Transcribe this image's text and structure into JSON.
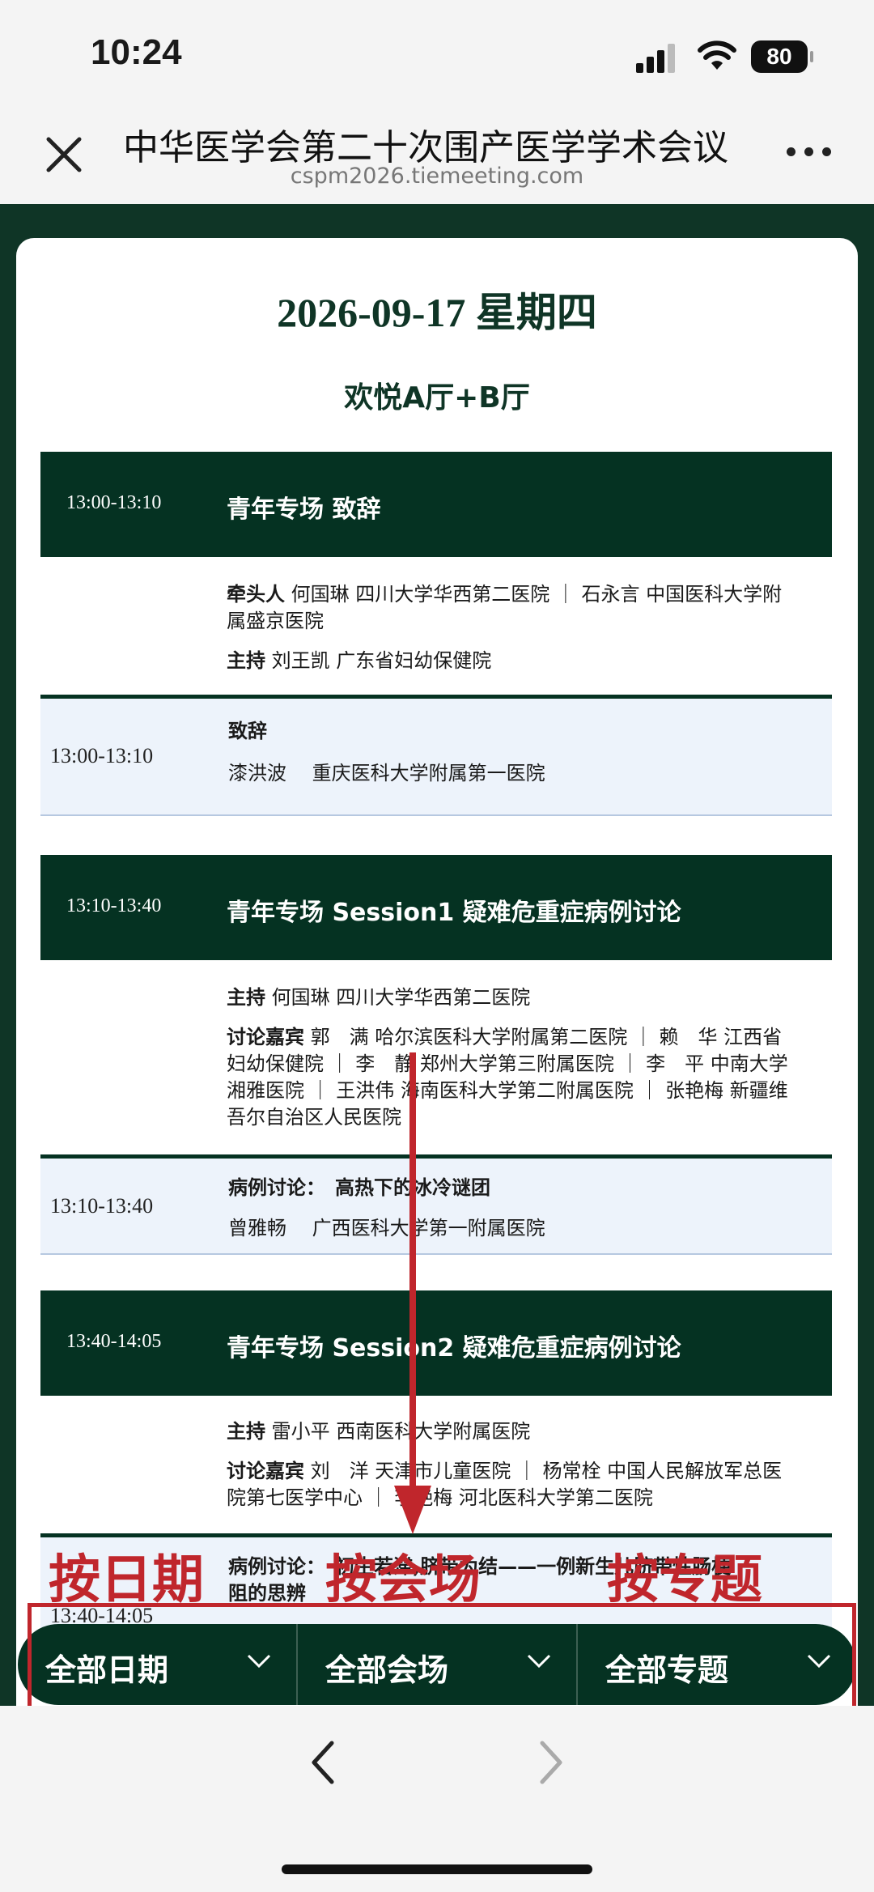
{
  "status": {
    "time": "10:24",
    "battery": "80"
  },
  "browser": {
    "title": "中华医学会第二十次围产医学学术会议",
    "url": "cspm2026.tiemeeting.com"
  },
  "schedule": {
    "date": "2026-09-17 星期四",
    "hall": "欢悦A厅+B厅",
    "sessions": [
      {
        "time": "13:00-13:10",
        "title": "青年专场 致辞",
        "leader_label": "牵头人",
        "leader_line1": "何国琳 四川大学华西第二医院 ｜ 石永言 中国医科大学附",
        "leader_line2": "属盛京医院",
        "host_label": "主持",
        "host": "刘王凯 广东省妇幼保健院",
        "talk": {
          "time": "13:00-13:10",
          "title": "致辞",
          "speaker": "漆洪波　 重庆医科大学附属第一医院"
        }
      },
      {
        "time": "13:10-13:40",
        "title": "青年专场 Session1 疑难危重症病例讨论",
        "host_label": "主持",
        "host": "何国琳 四川大学华西第二医院",
        "guests_label": "讨论嘉宾",
        "guests_line1": "郭　满 哈尔滨医科大学附属第二医院 ｜ 赖　华 江西省",
        "guests_line2": "妇幼保健院 ｜ 李　静 郑州大学第三附属医院 ｜ 李　平 中南大学",
        "guests_line3": "湘雅医院 ｜ 王洪伟 海南医科大学第二附属医院 ｜ 张艳梅 新疆维",
        "guests_line4": "吾尔自治区人民医院",
        "talk": {
          "time": "13:10-13:40",
          "title": "病例讨论：　高热下的冰冷谜团",
          "speaker": "曾雅畅　 广西医科大学第一附属医院"
        }
      },
      {
        "time": "13:40-14:05",
        "title": "青年专场 Session2 疑难危重症病例讨论",
        "host_label": "主持",
        "host": "雷小平 西南医科大学附属医院",
        "guests_label": "讨论嘉宾",
        "guests_line1": "刘　洋 天津市儿童医院 ｜ 杨常栓 中国人民解放军总医",
        "guests_line2": "院第七医学中心 ｜ 李艳梅 河北医科大学第二医院",
        "talk": {
          "time": "13:40-14:05",
          "title_line1": "病例讨论：　初生若滞,脐带为结——一例新生儿脐带性肠梗",
          "title_line2": "阻的思辨"
        }
      }
    ]
  },
  "annotations": {
    "by_date": "按日期",
    "by_venue": "按会场",
    "by_topic": "按专题",
    "color": "#c0262c"
  },
  "filters": {
    "date": "全部日期",
    "venue": "全部会场",
    "topic": "全部专题"
  },
  "colors": {
    "primary": "#053222",
    "talk_bg": "#edf3fb"
  }
}
